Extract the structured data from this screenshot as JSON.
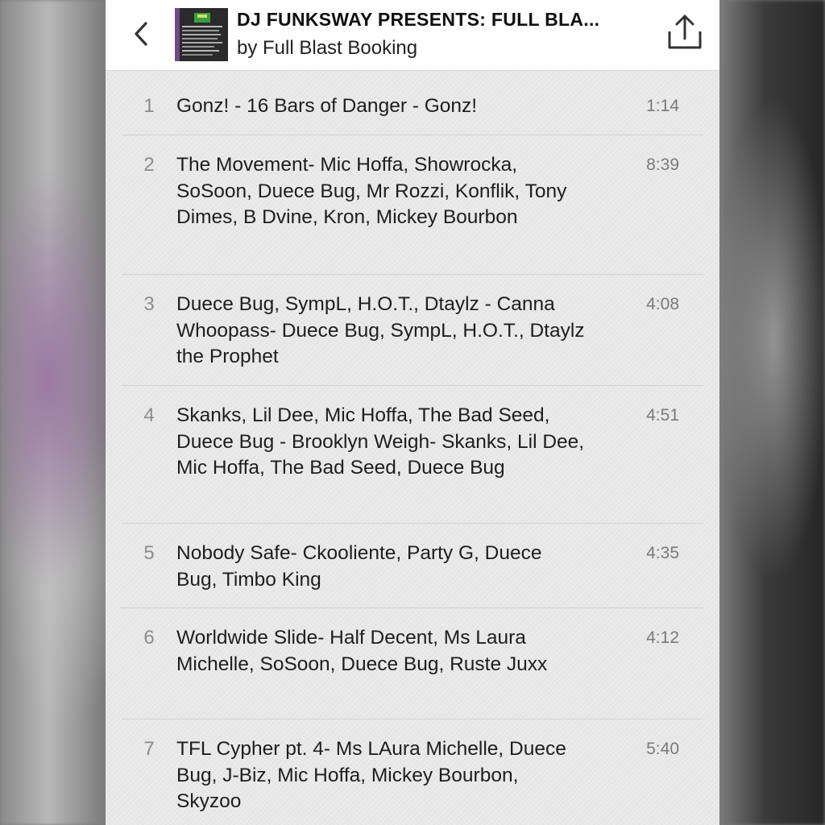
{
  "header": {
    "back_icon": "chevron-left-icon",
    "title": "DJ FUNKSWAY PRESENTS: FULL BLA...",
    "subtitle": "by Full Blast Booking",
    "share_icon": "share-icon"
  },
  "tracks": [
    {
      "number": "1",
      "title": "Gonz! - 16 Bars of Danger - Gonz!",
      "duration": "1:14"
    },
    {
      "number": "2",
      "title": "The Movement- Mic Hoffa, Showrocka, SoSoon, Duece Bug, Mr Rozzi, Konflik, Tony Dimes, B Dvine, Kron, Mickey Bourbon",
      "duration": "8:39"
    },
    {
      "number": "3",
      "title": "Duece Bug, SympL, H.O.T., Dtaylz - Canna Whoopass- Duece Bug, SympL, H.O.T., Dtaylz the Prophet",
      "duration": "4:08"
    },
    {
      "number": "4",
      "title": "Skanks, Lil Dee, Mic Hoffa, The Bad Seed, Duece Bug - Brooklyn Weigh- Skanks, Lil Dee, Mic Hoffa, The Bad Seed, Duece Bug",
      "duration": "4:51"
    },
    {
      "number": "5",
      "title": "Nobody Safe- Ckooliente, Party G, Duece Bug, Timbo King",
      "duration": "4:35"
    },
    {
      "number": "6",
      "title": "Worldwide Slide- Half Decent, Ms Laura Michelle, SoSoon, Duece Bug, Ruste Juxx",
      "duration": "4:12"
    },
    {
      "number": "7",
      "title": "TFL Cypher pt. 4- Ms LAura Michelle, Duece Bug, J-Biz, Mic Hoffa, Mickey Bourbon, Skyzoo",
      "duration": "5:40"
    }
  ]
}
